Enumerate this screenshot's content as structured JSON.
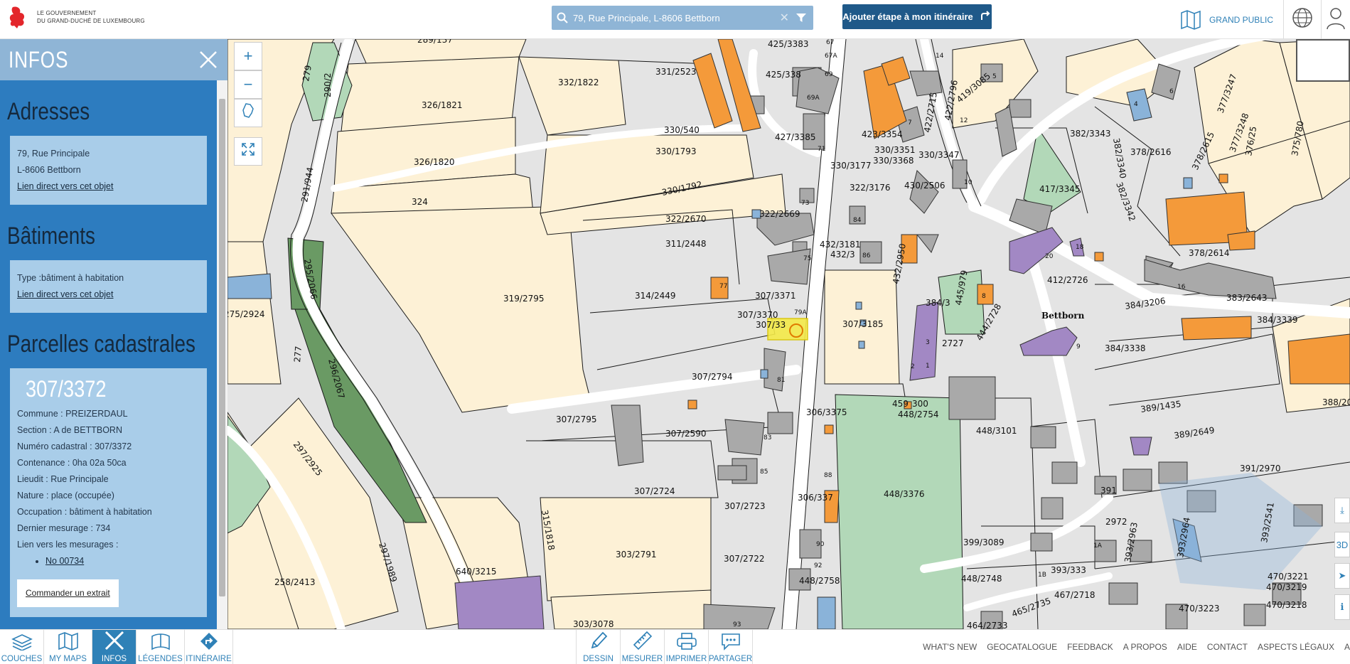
{
  "header": {
    "logo_line1": "LE GOUVERNEMENT",
    "logo_line2": "DU GRAND-DUCHÉ DE LUXEMBOURG",
    "search_value": "79, Rue Principale, L-8606 Bettborn",
    "route_button": "Ajouter étape à mon itinéraire",
    "audience": "GRAND PUBLIC"
  },
  "panel": {
    "title": "INFOS",
    "addresses": {
      "title": "Adresses",
      "line1": "79, Rue Principale",
      "line2": "L-8606 Bettborn",
      "link": "Lien direct vers cet objet"
    },
    "buildings": {
      "title": "Bâtiments",
      "type": "Type :bâtiment à habitation",
      "link": "Lien direct vers cet objet"
    },
    "parcels": {
      "title": "Parcelles cadastrales",
      "number": "307/3372",
      "commune": "Commune : PREIZERDAUL",
      "section": "Section : A de BETTBORN",
      "cadastral": "Numéro cadastral : 307/3372",
      "area": "Contenance : 0ha 02a 50ca",
      "lieudit": "Lieudit : Rue Principale",
      "nature": "Nature : place (occupée)",
      "occupation": "Occupation : bâtiment à habitation",
      "last_survey": "Dernier mesurage : 734",
      "survey_links": "Lien vers les mesurages :",
      "survey_item": "No 00734",
      "order_button": "Commander un extrait"
    }
  },
  "bottom_left": [
    "COUCHES",
    "MY MAPS",
    "INFOS",
    "LÉGENDES",
    "ITINÉRAIRE"
  ],
  "bottom_center": [
    "DESSIN",
    "MESURER",
    "IMPRIMER",
    "PARTAGER"
  ],
  "bottom_right": [
    "WHAT'S NEW",
    "GEOCATALOGUE",
    "FEEDBACK",
    "A PROPOS",
    "AIDE",
    "CONTACT",
    "ASPECTS LÉGAUX",
    "A"
  ],
  "map_controls": {
    "zoom_in": "+",
    "zoom_out": "−",
    "mode_3d": "3D"
  },
  "map_labels": {
    "town": "Bettborn",
    "parcels": [
      "289/137",
      "425/3383",
      "331/2523",
      "332/1822",
      "425/338",
      "326/1821",
      "330/540",
      "427/3385",
      "330/1793",
      "326/1820",
      "330/3177",
      "330/3351",
      "330/3368",
      "330/3347",
      "324",
      "330/1792",
      "322/3176",
      "430/2506",
      "322/2670",
      "322/2669",
      "311/2448",
      "432/3181",
      "432/3",
      "314/2449",
      "307/3371",
      "319/2795",
      "307/3370",
      "307/33",
      "307/3185",
      "307/2794",
      "306/3375",
      "459",
      "300",
      "448/2754",
      "448/3101",
      "307/2795",
      "307/2590",
      "307/2724",
      "306/337",
      "448/3376",
      "307/2723",
      "303/2791",
      "307/2722",
      "640/3215",
      "258/2413",
      "303/3078",
      "448/2758",
      "448/2748",
      "399/3089",
      "393/333",
      "467/2718",
      "464/2733",
      "465/2735",
      "275/2924",
      "295/2066",
      "296/2067",
      "297/2925",
      "297/1989",
      "291/944",
      "290/2",
      "279",
      "277",
      "315/1818",
      "417/3345",
      "412/2726",
      "382/3343",
      "378/2616",
      "378/2614",
      "384/3206",
      "383/2643",
      "384/3339",
      "384/3338",
      "389/1435",
      "389/2649",
      "388/20",
      "391/2970",
      "470/3221",
      "470/3219",
      "470/3218",
      "470/3223",
      "419/3085",
      "422/2796",
      "422/2715",
      "423/3354",
      "432/2950",
      "445/979",
      "444/2728",
      "2727",
      "384/3",
      "382/3340",
      "382/3342",
      "377/3247",
      "377/3248",
      "376/25",
      "375/780",
      "378/2615",
      "393/2541",
      "393/2964",
      "393/2963",
      "2972",
      "391",
      "1B"
    ],
    "numbers": [
      "67",
      "67A",
      "69",
      "69A",
      "71",
      "73",
      "75",
      "77",
      "79A",
      "81",
      "83",
      "85",
      "86",
      "84",
      "88",
      "90",
      "92",
      "93",
      "14",
      "5",
      "7",
      "12",
      "10",
      "6",
      "4",
      "8",
      "3",
      "1",
      "2",
      "9",
      "16",
      "18",
      "20",
      "1A"
    ]
  },
  "colors": {
    "panel_blue": "#2d7cbf",
    "panel_header": "#8fb5d6",
    "box_blue": "#a9cde9",
    "parcel_yellow": "#fdf1d6",
    "road_white": "#ffffff",
    "background_grey": "#e4e4e4",
    "building_grey": "#a9a9a9",
    "orange": "#f49a3a",
    "purple": "#a288c4",
    "green_light": "#b2d8b8",
    "green_dark": "#6a9a64",
    "highlight": "#f4ea48"
  },
  "icons": [
    "lion-logo-icon",
    "search-icon",
    "close-icon",
    "filter-icon",
    "route-arrow-icon",
    "map-icon",
    "globe-icon",
    "user-icon",
    "layers-icon",
    "mymaps-icon",
    "infos-icon",
    "legend-icon",
    "itinerary-icon",
    "pencil-icon",
    "ruler-icon",
    "printer-icon",
    "share-icon",
    "fullscreen-icon",
    "map-shape-icon",
    "location-icon",
    "info-icon",
    "download-icon"
  ]
}
